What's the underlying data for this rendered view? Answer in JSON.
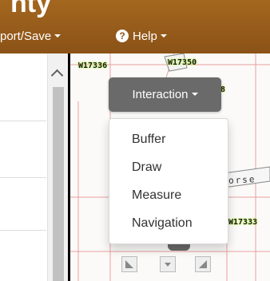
{
  "header": {
    "title_fragment": "nty",
    "export_menu_label": "port/Save",
    "help_menu_label": "Help"
  },
  "map": {
    "parcel_labels": [
      "W17336",
      "W17350",
      "W17333"
    ],
    "street_label": "orse",
    "partial_labels": [
      "8"
    ]
  },
  "interaction": {
    "button_label": "Interaction",
    "menu_items": [
      {
        "label": "Buffer"
      },
      {
        "label": "Draw"
      },
      {
        "label": "Measure"
      },
      {
        "label": "Navigation"
      }
    ]
  },
  "icons": {
    "help": "question-circle-icon",
    "scroll_up": "chevron-up-icon",
    "corner_left": "resize-bottom-left-icon",
    "corner_middle": "chevron-down-icon",
    "corner_right": "resize-bottom-right-icon"
  },
  "colors": {
    "header_brown": "#8e5519",
    "button_gray": "#6a6a6a",
    "parcel_line": "#e8a0a0",
    "label_halo": "#c9f76a"
  }
}
